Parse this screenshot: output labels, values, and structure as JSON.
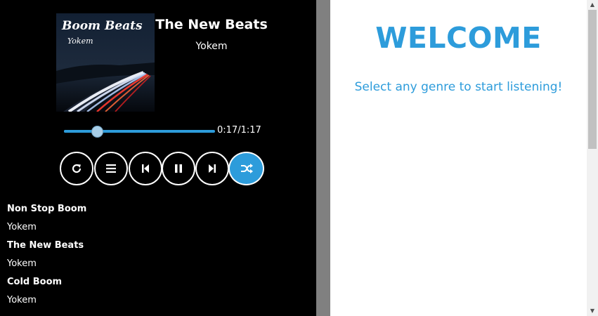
{
  "player": {
    "cover": {
      "title": "Boom Beats",
      "subtitle": "Yokem"
    },
    "now_playing": {
      "title": "The New Beats",
      "artist": "Yokem"
    },
    "progress": {
      "time": "0:17/1:17",
      "fraction": 0.2208
    },
    "controls": [
      {
        "name": "repeat-button",
        "icon": "repeat-icon",
        "active": false
      },
      {
        "name": "playlist-button",
        "icon": "list-icon",
        "active": false
      },
      {
        "name": "previous-button",
        "icon": "skip-previous-icon",
        "active": false
      },
      {
        "name": "pause-button",
        "icon": "pause-icon",
        "active": false
      },
      {
        "name": "next-button",
        "icon": "skip-next-icon",
        "active": false
      },
      {
        "name": "shuffle-button",
        "icon": "shuffle-icon",
        "active": true
      }
    ],
    "playlist": [
      {
        "title": "Non Stop Boom",
        "artist": "Yokem"
      },
      {
        "title": "The New Beats",
        "artist": "Yokem"
      },
      {
        "title": "Cold Boom",
        "artist": "Yokem"
      }
    ]
  },
  "main": {
    "heading": "WELCOME",
    "subtitle": "Select any genre to start listening!"
  },
  "colors": {
    "accent": "#2d9cdb",
    "player_bg": "#000000",
    "divider": "#808080"
  }
}
